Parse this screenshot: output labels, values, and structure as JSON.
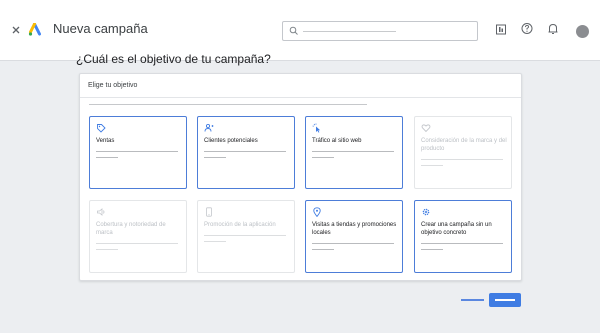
{
  "header": {
    "title": "Nueva campaña",
    "close_icon": "close-icon",
    "logo_icon": "google-ads-logo",
    "icons": [
      "reports-icon",
      "help-icon",
      "notifications-icon"
    ]
  },
  "page": {
    "question": "¿Cuál es el objetivo de tu campaña?"
  },
  "panel": {
    "header": "Elige tu objetivo"
  },
  "objectives": [
    {
      "label": "Ventas",
      "icon": "tag-icon",
      "enabled": true
    },
    {
      "label": "Clientes potenciales",
      "icon": "people-icon",
      "enabled": true
    },
    {
      "label": "Tráfico al sitio web",
      "icon": "cursor-click-icon",
      "enabled": true
    },
    {
      "label": "Consideración de la marca y del producto",
      "icon": "heart-icon",
      "enabled": false
    },
    {
      "label": "Cobertura y notoriedad de marca",
      "icon": "speaker-icon",
      "enabled": false
    },
    {
      "label": "Promoción de la aplicación",
      "icon": "phone-icon",
      "enabled": false
    },
    {
      "label": "Visitas a tiendas y promociones locales",
      "icon": "location-pin-icon",
      "enabled": true
    },
    {
      "label": "Crear una campaña sin un objetivo concreto",
      "icon": "gear-icon",
      "enabled": true
    }
  ],
  "colors": {
    "accent": "#3f7ce3",
    "card_border": "#4d7dd8",
    "background": "#eceef1"
  }
}
